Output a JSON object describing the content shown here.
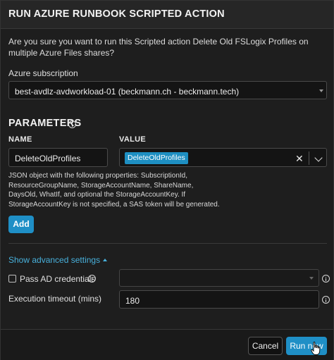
{
  "dialog": {
    "title": "RUN AZURE RUNBOOK SCRIPTED ACTION",
    "description": "Are you sure you want to run this Scripted action Delete Old FSLogix Profiles on multiple Azure Files shares?"
  },
  "subscription": {
    "label": "Azure subscription",
    "value": "best-avdlz-avdworkload-01 (beckmann.ch - beckmann.tech)"
  },
  "parameters": {
    "title": "PARAMETERS",
    "name_header": "NAME",
    "value_header": "VALUE",
    "name_value": "DeleteOldProfiles",
    "value_tag": "DeleteOldProfiles",
    "clear_symbol": "✕",
    "help_text": "JSON object with the following properties: SubscriptionId, ResourceGroupName, StorageAccountName, ShareName, DaysOld, WhatIf, and optional the StorageAccountKey. If StorageAccountKey is not specified, a SAS token will be generated.",
    "add_label": "Add"
  },
  "advanced": {
    "toggle_label": "Show advanced settings",
    "pass_ad_label": "Pass AD credentials",
    "pass_ad_checked": false,
    "pass_ad_value": "",
    "timeout_label": "Execution timeout (mins)",
    "timeout_value": "180"
  },
  "footer": {
    "cancel_label": "Cancel",
    "run_label": "Run now"
  },
  "colors": {
    "accent": "#1f8fc6",
    "link": "#48b0db",
    "background": "#1e1e1e"
  }
}
